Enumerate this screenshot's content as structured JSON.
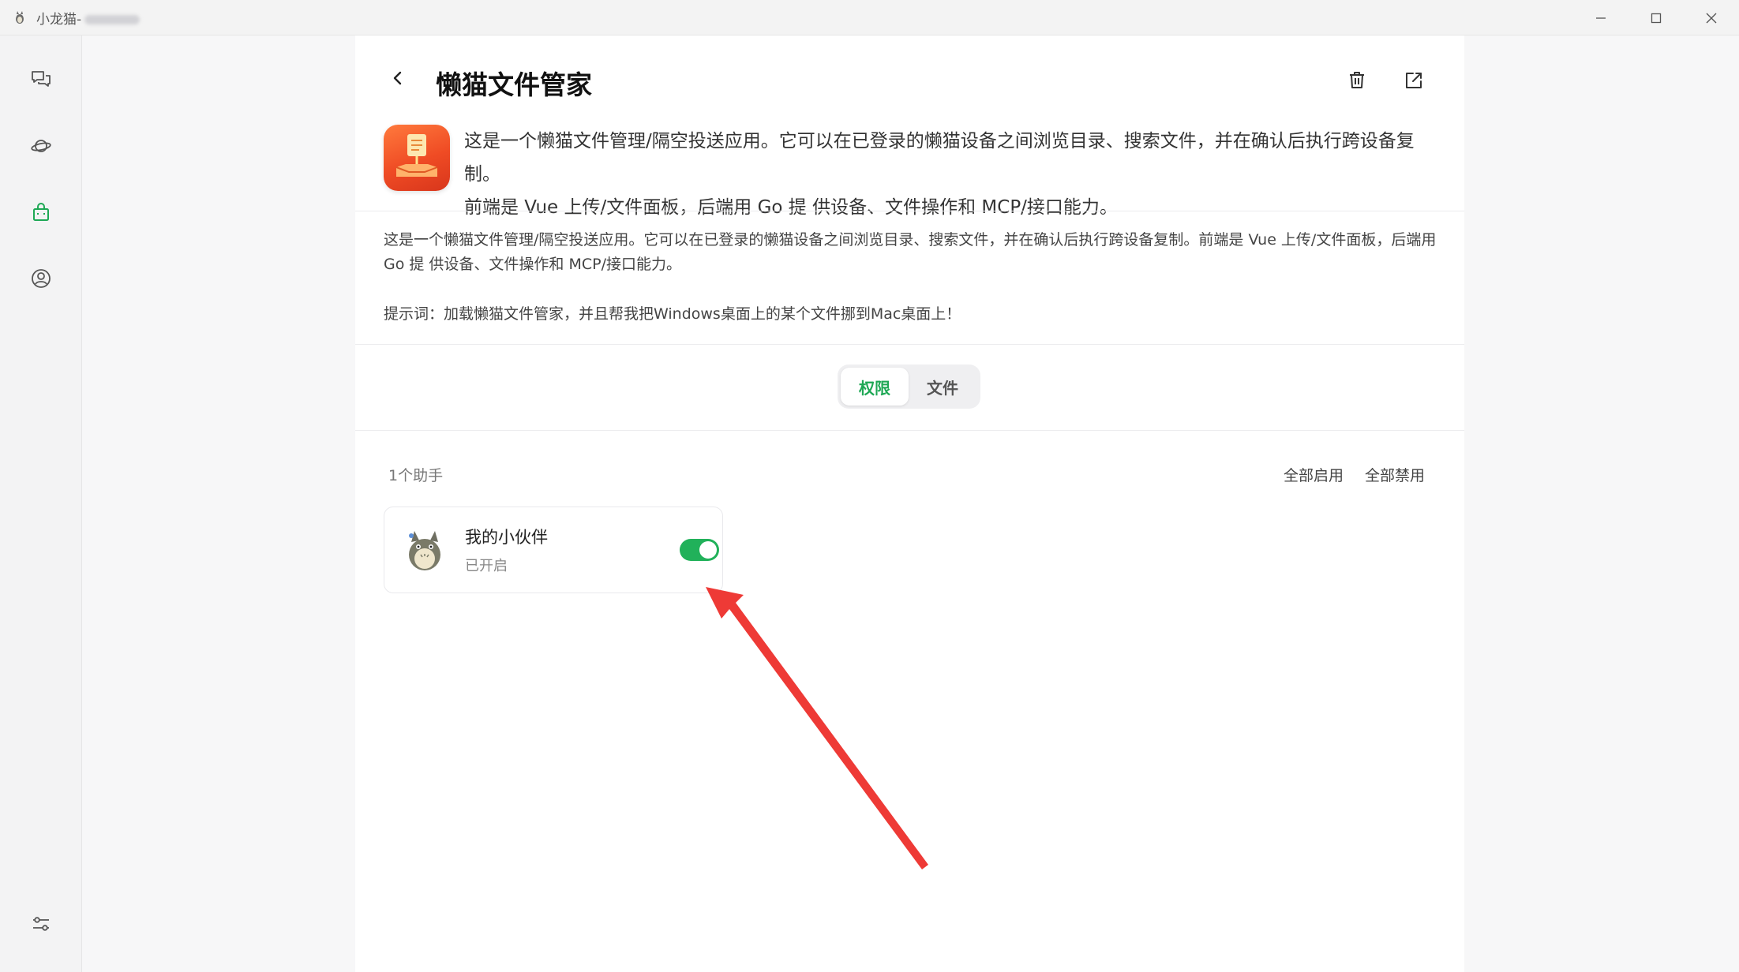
{
  "window": {
    "title": "小龙猫-"
  },
  "rail": {
    "items": [
      {
        "icon": "chat-bubbles-icon"
      },
      {
        "icon": "planet-icon"
      },
      {
        "icon": "shopping-bag-icon",
        "active": true
      },
      {
        "icon": "user-circle-icon"
      }
    ],
    "bottom_icon": "sliders-icon"
  },
  "header": {
    "title": "懒猫文件管家"
  },
  "intro": {
    "line1": "这是一个懒猫文件管理/隔空投送应用。它可以在已登录的懒猫设备之间浏览目录、搜索文件，并在确认后执行跨设备复制。",
    "line2": "前端是 Vue 上传/文件面板，后端用 Go 提 供设备、文件操作和 MCP/接口能力。"
  },
  "description": {
    "text": "这是一个懒猫文件管理/隔空投送应用。它可以在已登录的懒猫设备之间浏览目录、搜索文件，并在确认后执行跨设备复制。前端是 Vue 上传/文件面板，后端用 Go 提 供设备、文件操作和 MCP/接口能力。",
    "hint": "提示词：加载懒猫文件管家，并且帮我把Windows桌面上的某个文件挪到Mac桌面上！"
  },
  "tabs": {
    "permissions": "权限",
    "files": "文件",
    "active": "permissions"
  },
  "assistants": {
    "count_label": "1个助手",
    "enable_all": "全部启用",
    "disable_all": "全部禁用",
    "items": [
      {
        "name": "我的小伙伴",
        "status": "已开启",
        "enabled": true
      }
    ]
  },
  "colors": {
    "accent": "#1fa855",
    "toggle_on": "#21b15a",
    "annotation_arrow": "#ee3a36"
  }
}
